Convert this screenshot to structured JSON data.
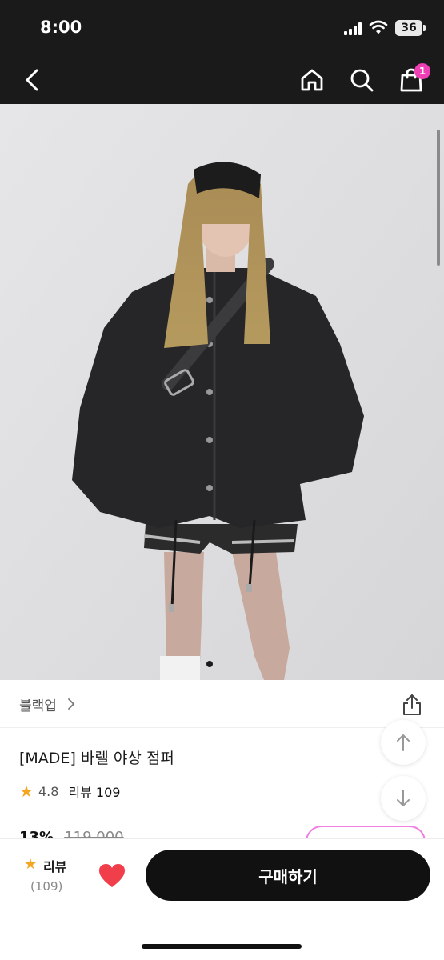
{
  "status_bar": {
    "time": "8:00",
    "battery": "36"
  },
  "nav": {
    "cart_count": "1"
  },
  "product": {
    "brand": "블랙업",
    "title": "[MADE] 바렐 야상 점퍼",
    "rating": "4.8",
    "review_link": "리뷰 109",
    "discount": "13%",
    "original_price": "119,000"
  },
  "bottom_bar": {
    "review_label": "리뷰",
    "review_count": "(109)",
    "buy_label": "구매하기"
  },
  "colors": {
    "accent": "#ef3fb5",
    "star": "#f4a623",
    "heart": "#f03e4a",
    "dark": "#1a1a1a"
  }
}
